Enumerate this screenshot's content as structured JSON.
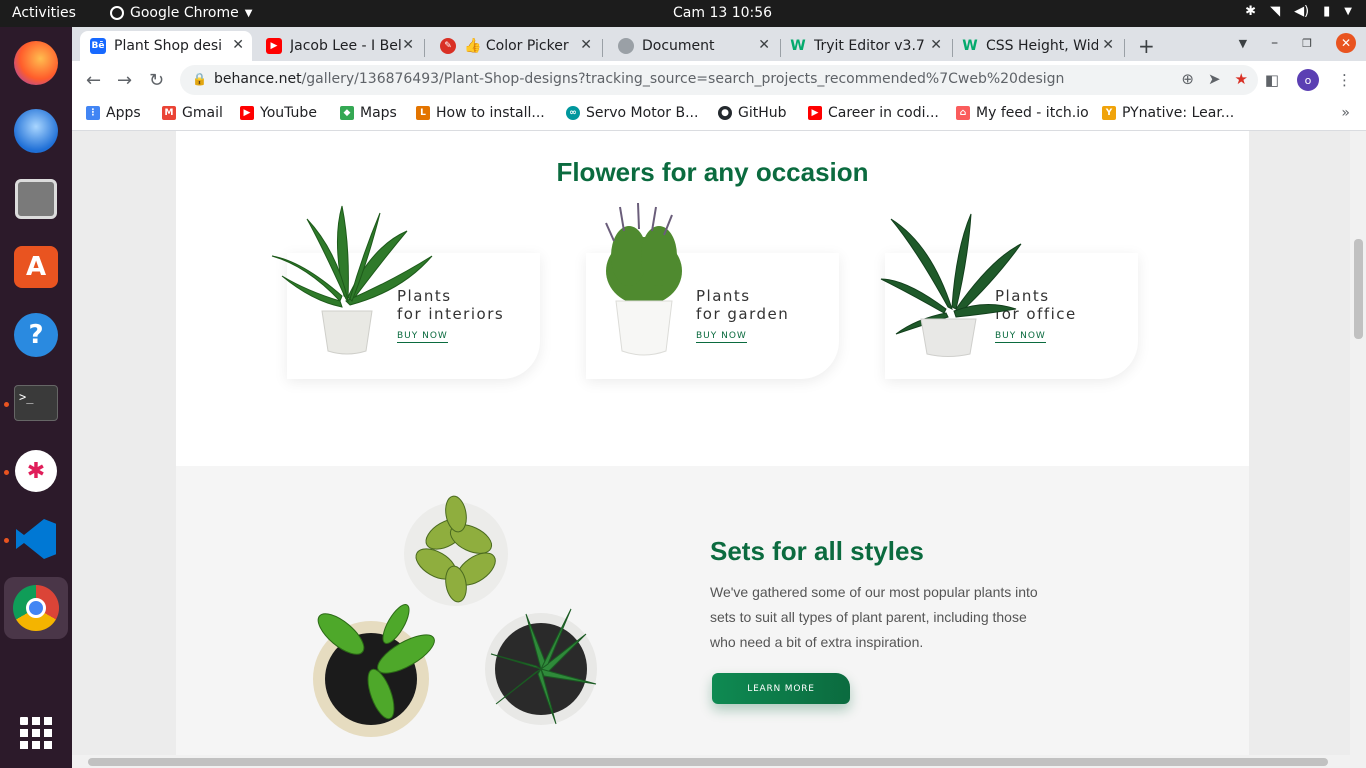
{
  "system": {
    "activities": "Activities",
    "app_name": "Google Chrome",
    "clock": "Cam 13  10:56"
  },
  "tabs": [
    {
      "title": "Plant Shop desi",
      "favicon": "behance-icon",
      "color": "#1769ff",
      "active": true
    },
    {
      "title": "Jacob Lee - I Bel",
      "favicon": "youtube-icon",
      "color": "#ff0000"
    },
    {
      "title": "👍 Color Picker",
      "favicon": "color-picker-icon",
      "color": "#d93025"
    },
    {
      "title": "Document",
      "favicon": "globe-icon",
      "color": "#9aa0a6"
    },
    {
      "title": "Tryit Editor v3.7",
      "favicon": "w3schools-icon",
      "color": "#04aa6d"
    },
    {
      "title": "CSS Height, Wid",
      "favicon": "w3schools-icon",
      "color": "#04aa6d"
    }
  ],
  "omnibox": {
    "domain": "behance.net",
    "path": "/gallery/136876493/Plant-Shop-designs?tracking_source=search_projects_recommended%7Cweb%20design"
  },
  "profile_initial": "o",
  "bookmarks": [
    {
      "label": "Apps",
      "color": "#4285f4"
    },
    {
      "label": "Gmail",
      "color": "#ea4335"
    },
    {
      "label": "YouTube",
      "color": "#ff0000"
    },
    {
      "label": "Maps",
      "color": "#34a853"
    },
    {
      "label": "How to install...",
      "color": "#e37400"
    },
    {
      "label": "Servo Motor B...",
      "color": "#00979d"
    },
    {
      "label": "GitHub",
      "color": "#24292e"
    },
    {
      "label": "Career in codi...",
      "color": "#ff0000"
    },
    {
      "label": "My feed - itch.io",
      "color": "#fa5c5c"
    },
    {
      "label": "PYnative: Lear...",
      "color": "#f0a30a"
    }
  ],
  "page": {
    "flowers_title": "Flowers for any occasion",
    "cards": [
      {
        "line1": "Plants",
        "line2": "for interiors",
        "cta": "BUY NOW"
      },
      {
        "line1": "Plants",
        "line2": "for garden",
        "cta": "BUY NOW"
      },
      {
        "line1": "Plants",
        "line2": "for office",
        "cta": "BUY NOW"
      }
    ],
    "sets_title": "Sets for all styles",
    "sets_description": "We've gathered some of our most popular plants into sets to suit all types of plant parent, including those  who need a bit of extra inspiration.",
    "learn_more": "LEARN MORE"
  },
  "colors": {
    "brand_green": "#0b6b3f",
    "ubuntu_orange": "#e95420"
  }
}
